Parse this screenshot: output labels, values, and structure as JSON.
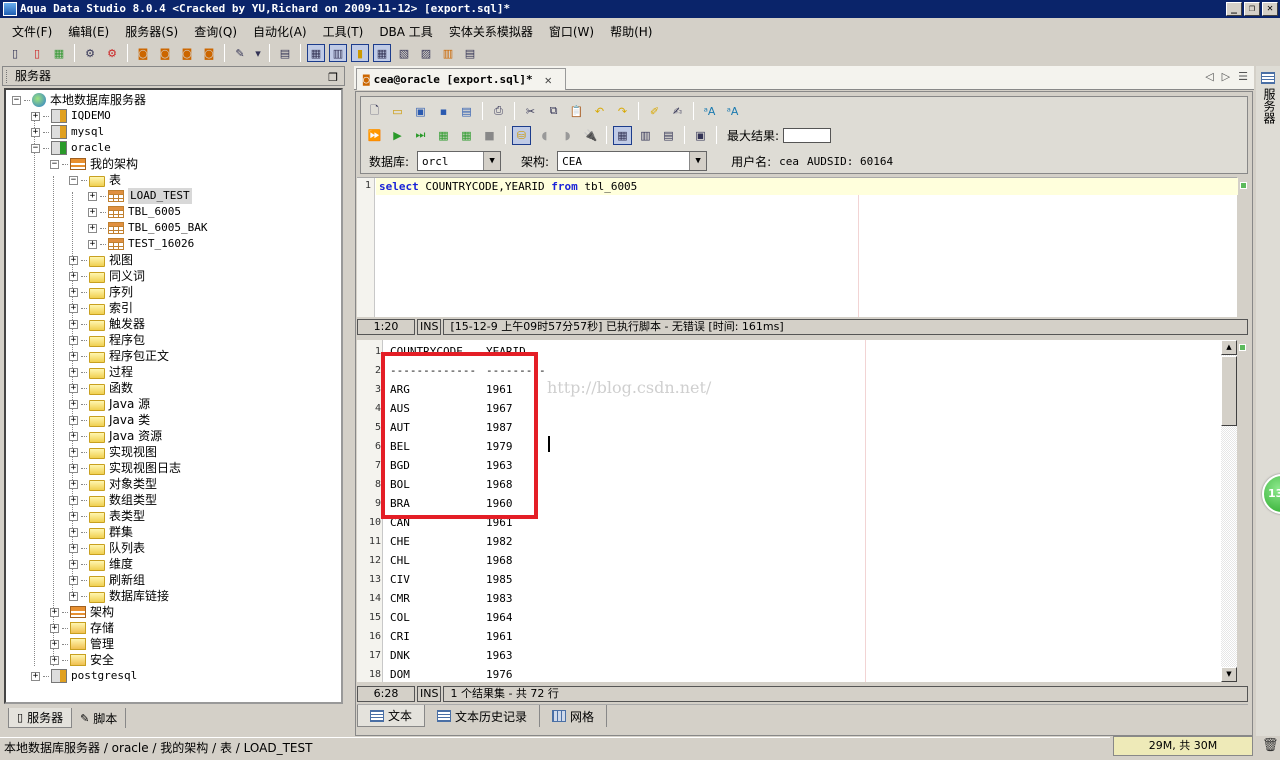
{
  "window": {
    "title": "Aqua Data Studio 8.0.4 <Cracked by YU,Richard on 2009-11-12>  [export.sql]*",
    "buttons": {
      "minimize": "_",
      "restore": "❐",
      "close": "✕"
    }
  },
  "menu": [
    "文件(F)",
    "编辑(E)",
    "服务器(S)",
    "查询(Q)",
    "自动化(A)",
    "工具(T)",
    "DBA 工具",
    "实体关系模拟器",
    "窗口(W)",
    "帮助(H)"
  ],
  "left_panel": {
    "title": "服务器",
    "tree": {
      "root": "本地数据库服务器",
      "servers": [
        "IQDEMO",
        "mysql",
        "oracle",
        "postgresql"
      ],
      "schema": "我的架构",
      "tables_folder": "表",
      "tables": [
        "LOAD_TEST",
        "TBL_6005",
        "TBL_6005_BAK",
        "TEST_16026"
      ],
      "folders": [
        "视图",
        "同义词",
        "序列",
        "索引",
        "触发器",
        "程序包",
        "程序包正文",
        "过程",
        "函数",
        "Java 源",
        "Java 类",
        "Java 资源",
        "实现视图",
        "实现视图日志",
        "对象类型",
        "数组类型",
        "表类型",
        "群集",
        "队列表",
        "维度",
        "刷新组",
        "数据库链接"
      ],
      "oracle_children": [
        "架构",
        "存储",
        "管理",
        "安全"
      ],
      "selected": "LOAD_TEST"
    },
    "tabs": [
      "服务器",
      "脚本"
    ]
  },
  "breadcrumb": "本地数据库服务器 / oracle / 我的架构 / 表 / LOAD_TEST",
  "memory": "29M, 共 30M",
  "doc_tab": {
    "label": "cea@oracle [export.sql]*",
    "close": "✕"
  },
  "query_toolbar": {
    "max_results_label": "最大结果:",
    "max_results_value": "",
    "database_label": "数据库:",
    "database_value": "orcl",
    "schema_label": "架构:",
    "schema_value": "CEA",
    "user_label": "用户名:",
    "user_value": "cea",
    "audsid": "AUDSID: 60164"
  },
  "sql": {
    "line_number": "1",
    "kw_select": "select",
    "columns": " COUNTRYCODE,YEARID ",
    "kw_from": "from",
    "table": " tbl_6005"
  },
  "editor_status": {
    "position": "1:20",
    "mode": "INS",
    "message": "[15-12-9 上午09时57分57秒] 已执行脚本 - 无错误  [时间: 161ms]"
  },
  "results": {
    "header": [
      "COUNTRYCODE",
      "YEARID"
    ],
    "separator": [
      "-------------",
      "---------"
    ],
    "rows": [
      [
        "ARG",
        "1961"
      ],
      [
        "AUS",
        "1967"
      ],
      [
        "AUT",
        "1987"
      ],
      [
        "BEL",
        "1979"
      ],
      [
        "BGD",
        "1963"
      ],
      [
        "BOL",
        "1968"
      ],
      [
        "BRA",
        "1960"
      ],
      [
        "CAN",
        "1961"
      ],
      [
        "CHE",
        "1982"
      ],
      [
        "CHL",
        "1968"
      ],
      [
        "CIV",
        "1985"
      ],
      [
        "CMR",
        "1983"
      ],
      [
        "COL",
        "1964"
      ],
      [
        "CRI",
        "1961"
      ],
      [
        "DNK",
        "1963"
      ],
      [
        "DOM",
        "1976"
      ]
    ],
    "watermark": "http://blog.csdn.net/"
  },
  "result_status": {
    "position": "6:28",
    "mode": "INS",
    "message": "1 个结果集 - 共 72 行"
  },
  "result_tabs": [
    "文本",
    "文本历史记录",
    "网格"
  ],
  "right_strip": {
    "label": "服务器"
  },
  "bubble": "13"
}
